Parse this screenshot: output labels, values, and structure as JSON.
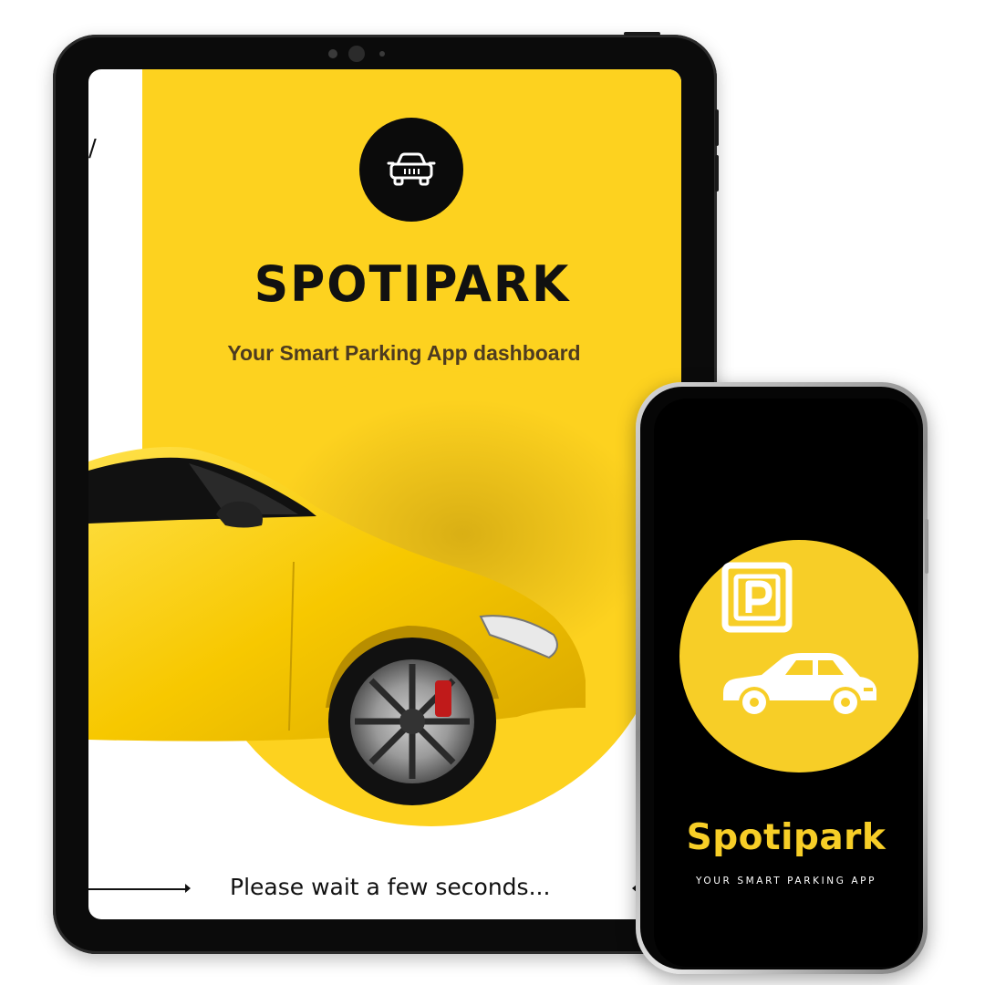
{
  "tablet": {
    "title": "SPOTIPARK",
    "subtitle": "Your Smart Parking  App dashboard",
    "corner_mark": "/",
    "loading_text": "Please wait a few seconds...",
    "logo_icon": "car-front-icon",
    "background_image": "yellow-sports-car"
  },
  "phone": {
    "title": "Spotipark",
    "subtitle": "YOUR SMART PARKING APP",
    "logo_icons": [
      "parking-sign-icon",
      "car-side-icon"
    ]
  },
  "colors": {
    "brand_yellow": "#fdd21f",
    "phone_yellow": "#f7ce27",
    "dark": "#0b0b0b",
    "subtitle_brown": "#4d3b20"
  }
}
